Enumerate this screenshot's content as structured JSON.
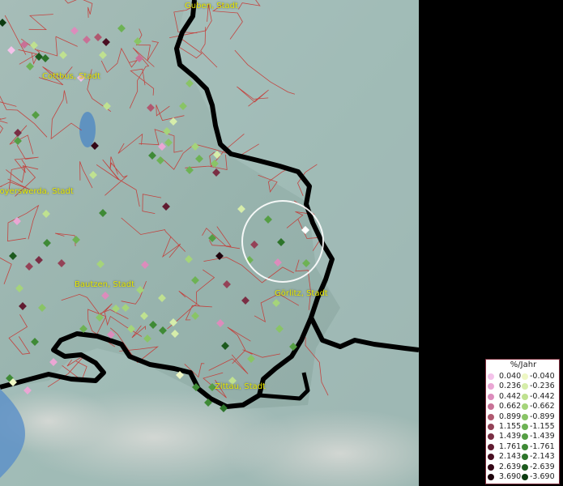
{
  "cities": {
    "guben": "Guben, Stadt",
    "cottbus": "Cottbus, Stadt",
    "hoyerswerda": "Hoyerswerda, Stadt",
    "bautzen": "Bautzen, Stadt",
    "goerlitz": "Görlitz, Stadt",
    "zittau": "Zittau, Stadt"
  },
  "legend": {
    "title": "%/Jahr",
    "positive": [
      "0.040",
      "0.236",
      "0.442",
      "0.662",
      "0.899",
      "1.155",
      "1.439",
      "1.761",
      "2.143",
      "2.639",
      "3.690"
    ],
    "negative": [
      "-0.040",
      "-0.236",
      "-0.442",
      "-0.662",
      "-0.899",
      "-1.155",
      "-1.439",
      "-1.761",
      "-2.143",
      "-2.639",
      "-3.690"
    ],
    "positive_colors": [
      "#f4c2ea",
      "#eaa6d4",
      "#dc8cbc",
      "#c87196",
      "#b0586f",
      "#944257",
      "#7a2e44",
      "#611c31",
      "#4a0f22",
      "#340716",
      "#1e030c"
    ],
    "negative_colors": [
      "#eef7c4",
      "#d6edaa",
      "#bfe190",
      "#a5d47a",
      "#89c466",
      "#6db254",
      "#559e44",
      "#3f8a36",
      "#2d742a",
      "#1c5a1e",
      "#0c3b10"
    ]
  },
  "colors": {
    "water_land": "#9fb8b4",
    "district_lines": "#c9302c",
    "border": "#000000",
    "highlight_circle": "#ffffff",
    "label_text": "#e8e800"
  }
}
